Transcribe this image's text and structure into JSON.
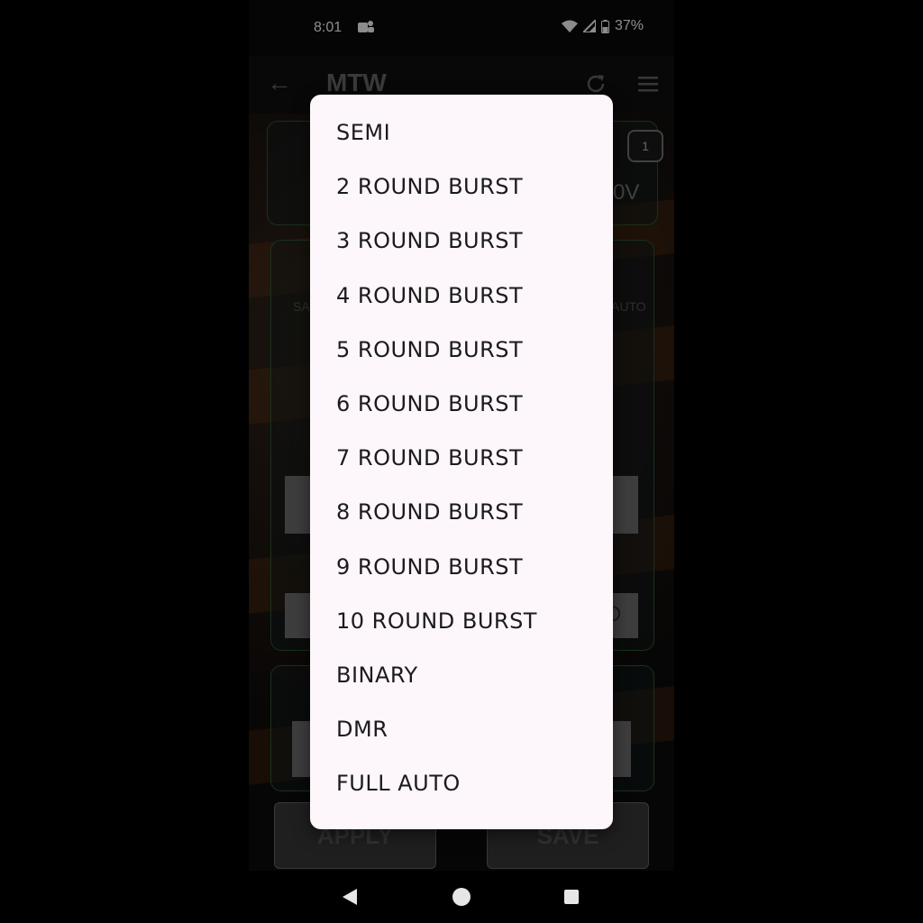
{
  "status_bar": {
    "time": "8:01",
    "battery": "37%",
    "icons": [
      "teams-icon",
      "wifi-icon",
      "signal-icon",
      "battery-icon"
    ]
  },
  "app_bar": {
    "title": "MTW",
    "icons": [
      "back-arrow-icon",
      "refresh-icon",
      "hamburger-menu-icon"
    ]
  },
  "background": {
    "badge": "1",
    "voltage_partial": "0V",
    "label_left_partial": "SA",
    "label_right_partial": "AUTO",
    "field_partial": "D",
    "apply_button": "APPLY",
    "save_button": "SAVE"
  },
  "dropdown": {
    "options": [
      "SEMI",
      "2 ROUND BURST",
      "3 ROUND BURST",
      "4 ROUND BURST",
      "5 ROUND BURST",
      "6 ROUND BURST",
      "7 ROUND BURST",
      "8 ROUND BURST",
      "9 ROUND BURST",
      "10 ROUND BURST",
      "BINARY",
      "DMR",
      "FULL AUTO"
    ]
  },
  "colors": {
    "menu_background": "#fdf6fb",
    "card_border": "#2c5a34"
  }
}
